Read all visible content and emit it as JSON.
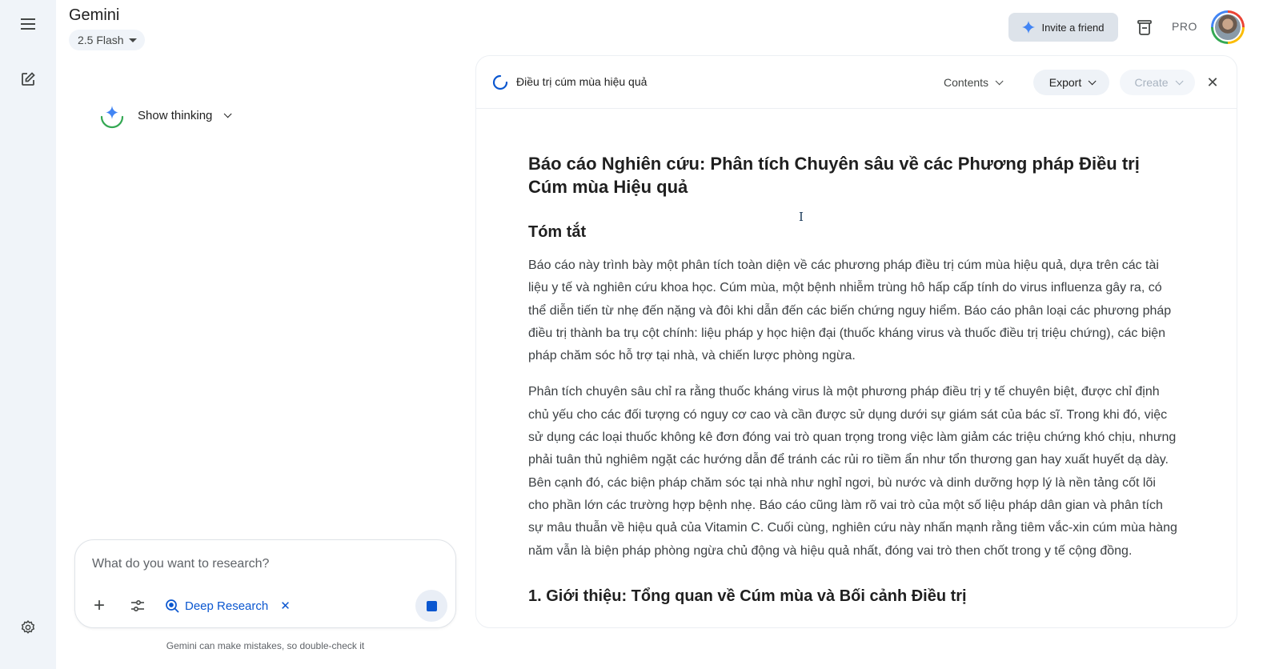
{
  "app": {
    "brand": "Gemini",
    "model_label": "2.5 Flash"
  },
  "header": {
    "invite_label": "Invite a friend",
    "plan_badge": "PRO"
  },
  "chat": {
    "show_thinking_label": "Show thinking",
    "composer": {
      "placeholder": "What do you want to research?",
      "tool_chip_label": "Deep Research"
    },
    "disclaimer": "Gemini can make mistakes, so double-check it"
  },
  "canvas": {
    "doc_title": "Điều trị cúm mùa hiệu quả",
    "toolbar": {
      "contents_label": "Contents",
      "export_label": "Export",
      "create_label": "Create"
    },
    "document": {
      "title": "Báo cáo Nghiên cứu: Phân tích Chuyên sâu về các Phương pháp Điều trị Cúm mùa Hiệu quả",
      "summary_heading": "Tóm tắt",
      "paragraphs": [
        "Báo cáo này trình bày một phân tích toàn diện về các phương pháp điều trị cúm mùa hiệu quả, dựa trên các tài liệu y tế và nghiên cứu khoa học. Cúm mùa, một bệnh nhiễm trùng hô hấp cấp tính do virus influenza gây ra, có thể diễn tiến từ nhẹ đến nặng và đôi khi dẫn đến các biến chứng nguy hiểm. Báo cáo phân loại các phương pháp điều trị thành ba trụ cột chính: liệu pháp y học hiện đại (thuốc kháng virus và thuốc điều trị triệu chứng), các biện pháp chăm sóc hỗ trợ tại nhà, và chiến lược phòng ngừa.",
        "Phân tích chuyên sâu chỉ ra rằng thuốc kháng virus là một phương pháp điều trị y tế chuyên biệt, được chỉ định chủ yếu cho các đối tượng có nguy cơ cao và cần được sử dụng dưới sự giám sát của bác sĩ. Trong khi đó, việc sử dụng các loại thuốc không kê đơn đóng vai trò quan trọng trong việc làm giảm các triệu chứng khó chịu, nhưng phải tuân thủ nghiêm ngặt các hướng dẫn để tránh các rủi ro tiềm ẩn như tổn thương gan hay xuất huyết dạ dày. Bên cạnh đó, các biện pháp chăm sóc tại nhà như nghỉ ngơi, bù nước và dinh dưỡng hợp lý là nền tảng cốt lõi cho phần lớn các trường hợp bệnh nhẹ. Báo cáo cũng làm rõ vai trò của một số liệu pháp dân gian và phân tích sự mâu thuẫn về hiệu quả của Vitamin C. Cuối cùng, nghiên cứu này nhấn mạnh rằng tiêm vắc-xin cúm mùa hàng năm vẫn là biện pháp phòng ngừa chủ động và hiệu quả nhất, đóng vai trò then chốt trong y tế cộng đồng."
      ],
      "section_1_heading": "1. Giới thiệu: Tổng quan về Cúm mùa và Bối cảnh Điều trị"
    }
  },
  "colors": {
    "accent": "#0b57d0",
    "rail_bg": "#f0f4f9"
  }
}
